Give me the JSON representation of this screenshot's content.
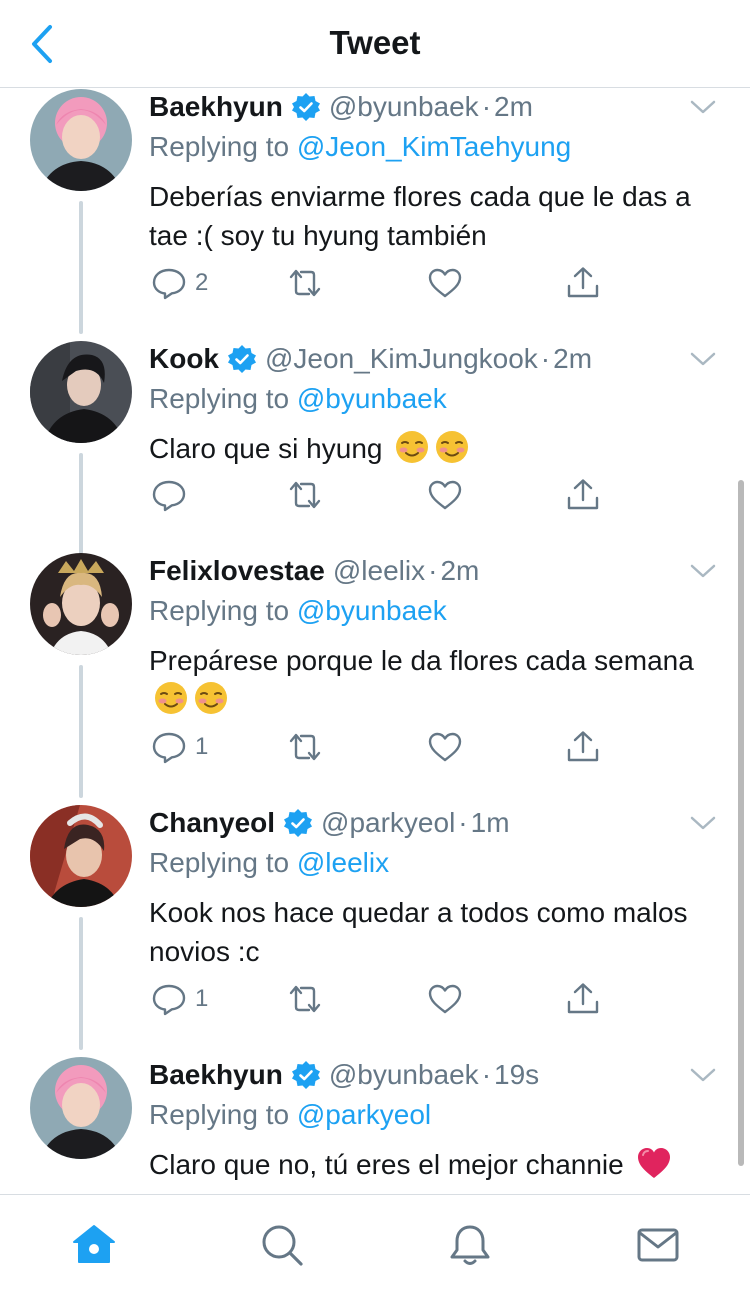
{
  "header": {
    "title": "Tweet",
    "back_icon": "chevron-left-icon"
  },
  "colors": {
    "accent": "#1da1f2",
    "muted": "#657786",
    "text": "#14171a",
    "heart": "#e0245e"
  },
  "tweets": [
    {
      "name": "Baekhyun",
      "verified": true,
      "handle": "@byunbaek",
      "dot": "·",
      "time": "2m",
      "reply_prefix": "Replying to",
      "reply_to": "@Jeon_KimTaehyung",
      "text": "Deberías enviarme flores cada que le das a tae :( soy tu hyung también",
      "emoji_count": 0,
      "reply_count": "2"
    },
    {
      "name": "Kook",
      "verified": true,
      "handle": "@Jeon_KimJungkook",
      "dot": "·",
      "time": "2m",
      "reply_prefix": "Replying to",
      "reply_to": "@byunbaek",
      "text": "Claro que si hyung",
      "emoji_count": 2,
      "emoji": "smiling-face-icon",
      "reply_count": ""
    },
    {
      "name": "Felixlovestae",
      "verified": false,
      "handle": "@leelix",
      "dot": "·",
      "time": "2m",
      "reply_prefix": "Replying to",
      "reply_to": "@byunbaek",
      "text": "Prepárese porque le da flores cada semana",
      "emoji_count": 2,
      "emoji": "smiling-face-icon",
      "reply_count": "1"
    },
    {
      "name": "Chanyeol",
      "verified": true,
      "handle": "@parkyeol",
      "dot": "·",
      "time": "1m",
      "reply_prefix": "Replying to",
      "reply_to": "@leelix",
      "text": "Kook nos hace quedar a todos como malos novios :c",
      "emoji_count": 0,
      "reply_count": "1"
    },
    {
      "name": "Baekhyun",
      "verified": true,
      "handle": "@byunbaek",
      "dot": "·",
      "time": "19s",
      "reply_prefix": "Replying to",
      "reply_to": "@parkyeol",
      "text": "Claro que no, tú eres el mejor channie",
      "emoji_count": 1,
      "emoji": "red-heart-icon",
      "reply_count": ""
    }
  ],
  "tabbar": {
    "items": [
      "home-icon",
      "search-icon",
      "bell-icon",
      "mail-icon"
    ],
    "active": "home-icon"
  }
}
